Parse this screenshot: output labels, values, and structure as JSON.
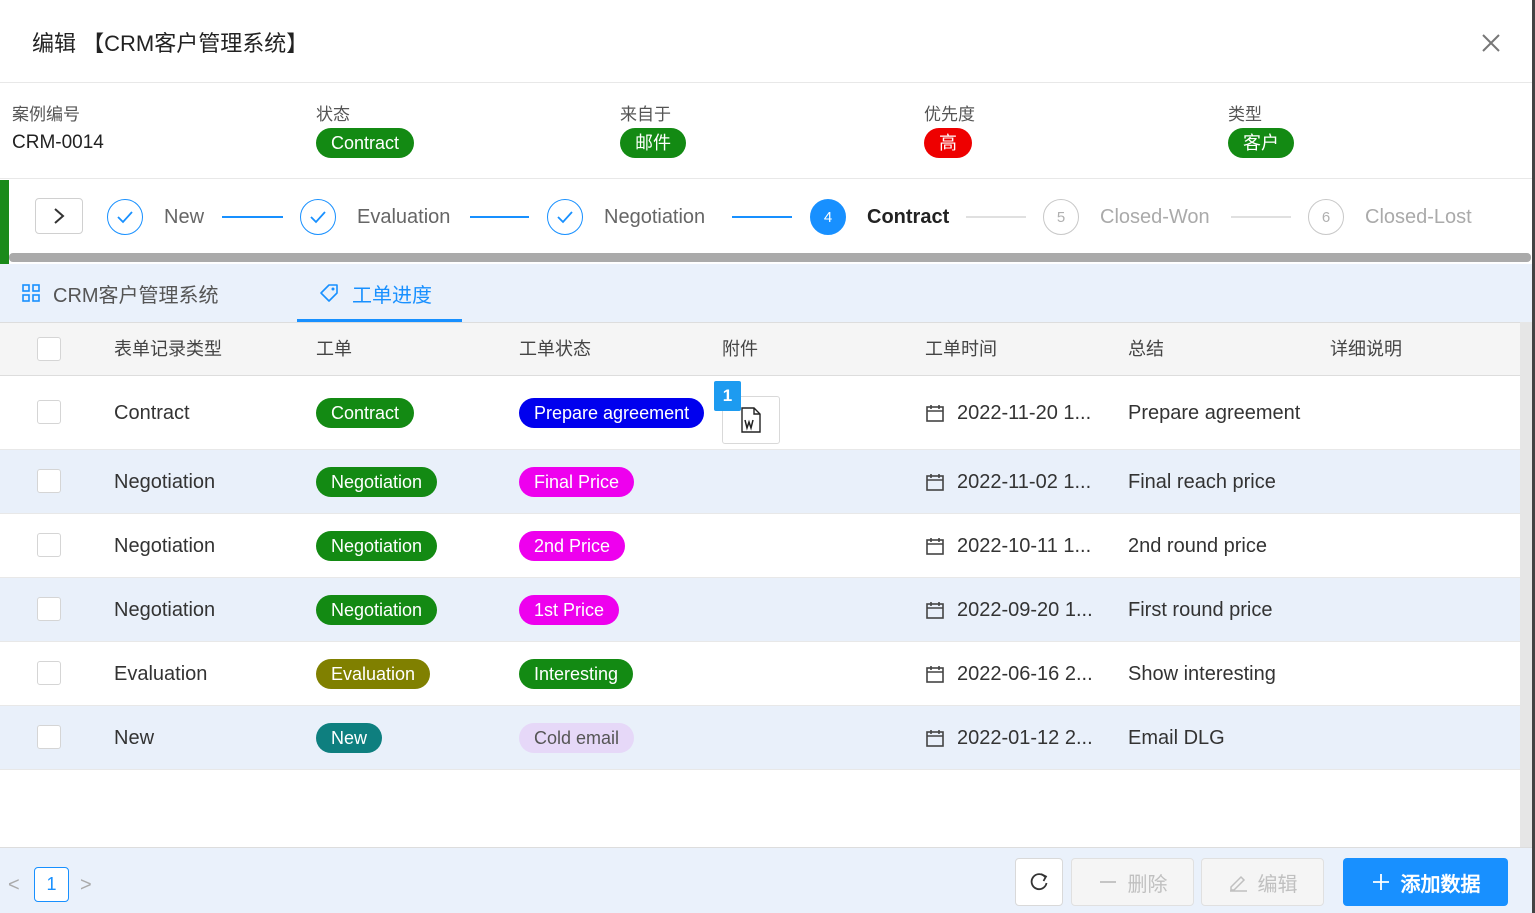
{
  "header": {
    "title": "编辑 【CRM客户管理系统】"
  },
  "info": {
    "case_no": {
      "label": "案例编号",
      "value": "CRM-0014"
    },
    "status": {
      "label": "状态",
      "value": "Contract",
      "color": "#138a13"
    },
    "source": {
      "label": "来自于",
      "value": "邮件",
      "color": "#138a13"
    },
    "priority": {
      "label": "优先度",
      "value": "高",
      "color": "#ee0000"
    },
    "type": {
      "label": "类型",
      "value": "客户",
      "color": "#138a13"
    }
  },
  "steps": [
    {
      "index": "1",
      "label": "New",
      "state": "done"
    },
    {
      "index": "2",
      "label": "Evaluation",
      "state": "done"
    },
    {
      "index": "3",
      "label": "Negotiation",
      "state": "done"
    },
    {
      "index": "4",
      "label": "Contract",
      "state": "active"
    },
    {
      "index": "5",
      "label": "Closed-Won",
      "state": "waiting"
    },
    {
      "index": "6",
      "label": "Closed-Lost",
      "state": "waiting"
    }
  ],
  "tabs": [
    {
      "label": "CRM客户管理系统"
    },
    {
      "label": "工单进度",
      "active": true
    }
  ],
  "table": {
    "columns": [
      "表单记录类型",
      "工单",
      "工单状态",
      "附件",
      "工单时间",
      "总结",
      "详细说明"
    ],
    "attachment_count": "1",
    "rows": [
      {
        "type": "Contract",
        "order": "Contract",
        "order_color": "#138a13",
        "status": "Prepare agreement",
        "status_bg": "#0000ee",
        "status_fg": "#ffffff",
        "time": "2022-11-20 1...",
        "summary": "Prepare agreement"
      },
      {
        "type": "Negotiation",
        "order": "Negotiation",
        "order_color": "#138a13",
        "status": "Final Price",
        "status_bg": "#ee00ee",
        "status_fg": "#ffffff",
        "time": "2022-11-02 1...",
        "summary": "Final reach price"
      },
      {
        "type": "Negotiation",
        "order": "Negotiation",
        "order_color": "#138a13",
        "status": "2nd Price",
        "status_bg": "#ee00ee",
        "status_fg": "#ffffff",
        "time": "2022-10-11 1...",
        "summary": "2nd round price"
      },
      {
        "type": "Negotiation",
        "order": "Negotiation",
        "order_color": "#138a13",
        "status": "1st Price",
        "status_bg": "#ee00ee",
        "status_fg": "#ffffff",
        "time": "2022-09-20 1...",
        "summary": "First round price"
      },
      {
        "type": "Evaluation",
        "order": "Evaluation",
        "order_color": "#808000",
        "status": "Interesting",
        "status_bg": "#138a13",
        "status_fg": "#ffffff",
        "time": "2022-06-16 2...",
        "summary": "Show interesting"
      },
      {
        "type": "New",
        "order": "New",
        "order_color": "#0e7f7f",
        "status": "Cold email",
        "status_bg": "#e6d8f8",
        "status_fg": "#555555",
        "time": "2022-01-12 2...",
        "summary": "Email DLG"
      }
    ]
  },
  "pagination": {
    "current": "1",
    "prev": "<",
    "next": ">"
  },
  "buttons": {
    "delete": "删除",
    "edit": "编辑",
    "add": "添加数据"
  },
  "icons": {
    "close": "close-icon",
    "expand": "chevron-right-icon",
    "check": "check-icon",
    "grid": "grid-icon",
    "tag": "tag-icon",
    "calendar": "calendar-icon",
    "word": "word-file-icon",
    "refresh": "refresh-icon",
    "minus": "minus-icon",
    "pencil": "pencil-icon",
    "plus": "plus-icon"
  }
}
